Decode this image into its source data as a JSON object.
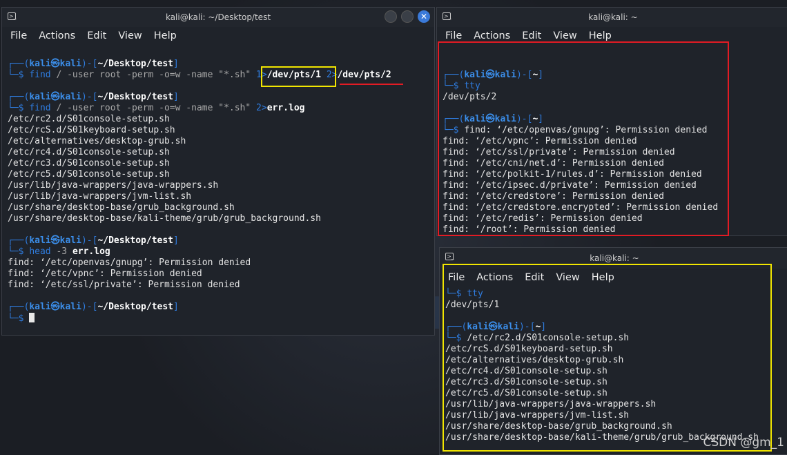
{
  "left_window": {
    "title": "kali@kali: ~/Desktop/test",
    "menu": [
      "File",
      "Actions",
      "Edit",
      "View",
      "Help"
    ],
    "close_glyph": "✕",
    "prompt_user": "kali",
    "prompt_at": "㉿",
    "prompt_host": "kali",
    "cwd": "~/Desktop/test",
    "blocks": [
      {
        "cmd": "find",
        "args_pre": "/ -user root -perm -o=w -name \"*.sh\" ",
        "redir1_fd": "1>",
        "redir1_target": "/dev/pts/1",
        "redir2_fd": "2>",
        "redir2_target": "/dev/pts/2",
        "output": []
      },
      {
        "cmd": "find",
        "args_pre": "/ -user root -perm -o=w -name \"*.sh\" ",
        "redir_fd": "2>",
        "redir_target": "err.log",
        "output": [
          "/etc/rc2.d/S01console-setup.sh",
          "/etc/rcS.d/S01keyboard-setup.sh",
          "/etc/alternatives/desktop-grub.sh",
          "/etc/rc4.d/S01console-setup.sh",
          "/etc/rc3.d/S01console-setup.sh",
          "/etc/rc5.d/S01console-setup.sh",
          "/usr/lib/java-wrappers/java-wrappers.sh",
          "/usr/lib/java-wrappers/jvm-list.sh",
          "/usr/share/desktop-base/grub_background.sh",
          "/usr/share/desktop-base/kali-theme/grub/grub_background.sh"
        ]
      },
      {
        "cmd": "head",
        "args_pre": "-3 ",
        "arg_bold": "err.log",
        "output": [
          "find: ‘/etc/openvas/gnupg’: Permission denied",
          "find: ‘/etc/vpnc’: Permission denied",
          "find: ‘/etc/ssl/private’: Permission denied"
        ]
      }
    ]
  },
  "top_right_window": {
    "title": "kali@kali: ~",
    "menu": [
      "File",
      "Actions",
      "Edit",
      "View",
      "Help"
    ],
    "cwd": "~",
    "tty_cmd": "tty",
    "tty_out": "/dev/pts/2",
    "first_line": "find: ‘/etc/openvas/gnupg’: Permission denied",
    "output": [
      "find: ‘/etc/vpnc’: Permission denied",
      "find: ‘/etc/ssl/private’: Permission denied",
      "find: ‘/etc/cni/net.d’: Permission denied",
      "find: ‘/etc/polkit-1/rules.d’: Permission denied",
      "find: ‘/etc/ipsec.d/private’: Permission denied",
      "find: ‘/etc/credstore’: Permission denied",
      "find: ‘/etc/credstore.encrypted’: Permission denied",
      "find: ‘/etc/redis’: Permission denied",
      "find: ‘/root’: Permission denied"
    ]
  },
  "bottom_right_window": {
    "title": "kali@kali: ~",
    "menu": [
      "File",
      "Actions",
      "Edit",
      "View",
      "Help"
    ],
    "cwd": "~",
    "tty_cmd": "tty",
    "tty_out": "/dev/pts/1",
    "first_line": "/etc/rc2.d/S01console-setup.sh",
    "output": [
      "/etc/rcS.d/S01keyboard-setup.sh",
      "/etc/alternatives/desktop-grub.sh",
      "/etc/rc4.d/S01console-setup.sh",
      "/etc/rc3.d/S01console-setup.sh",
      "/etc/rc5.d/S01console-setup.sh",
      "/usr/lib/java-wrappers/java-wrappers.sh",
      "/usr/lib/java-wrappers/jvm-list.sh",
      "/usr/share/desktop-base/grub_background.sh",
      "/usr/share/desktop-base/kali-theme/grub/grub_background.sh"
    ]
  },
  "desktop": {
    "watermark": "CSDN @gm_1"
  },
  "colors": {
    "highlight_yellow": "#f2e600",
    "highlight_red": "#e21b24",
    "prompt_blue": "#2f7de1"
  }
}
